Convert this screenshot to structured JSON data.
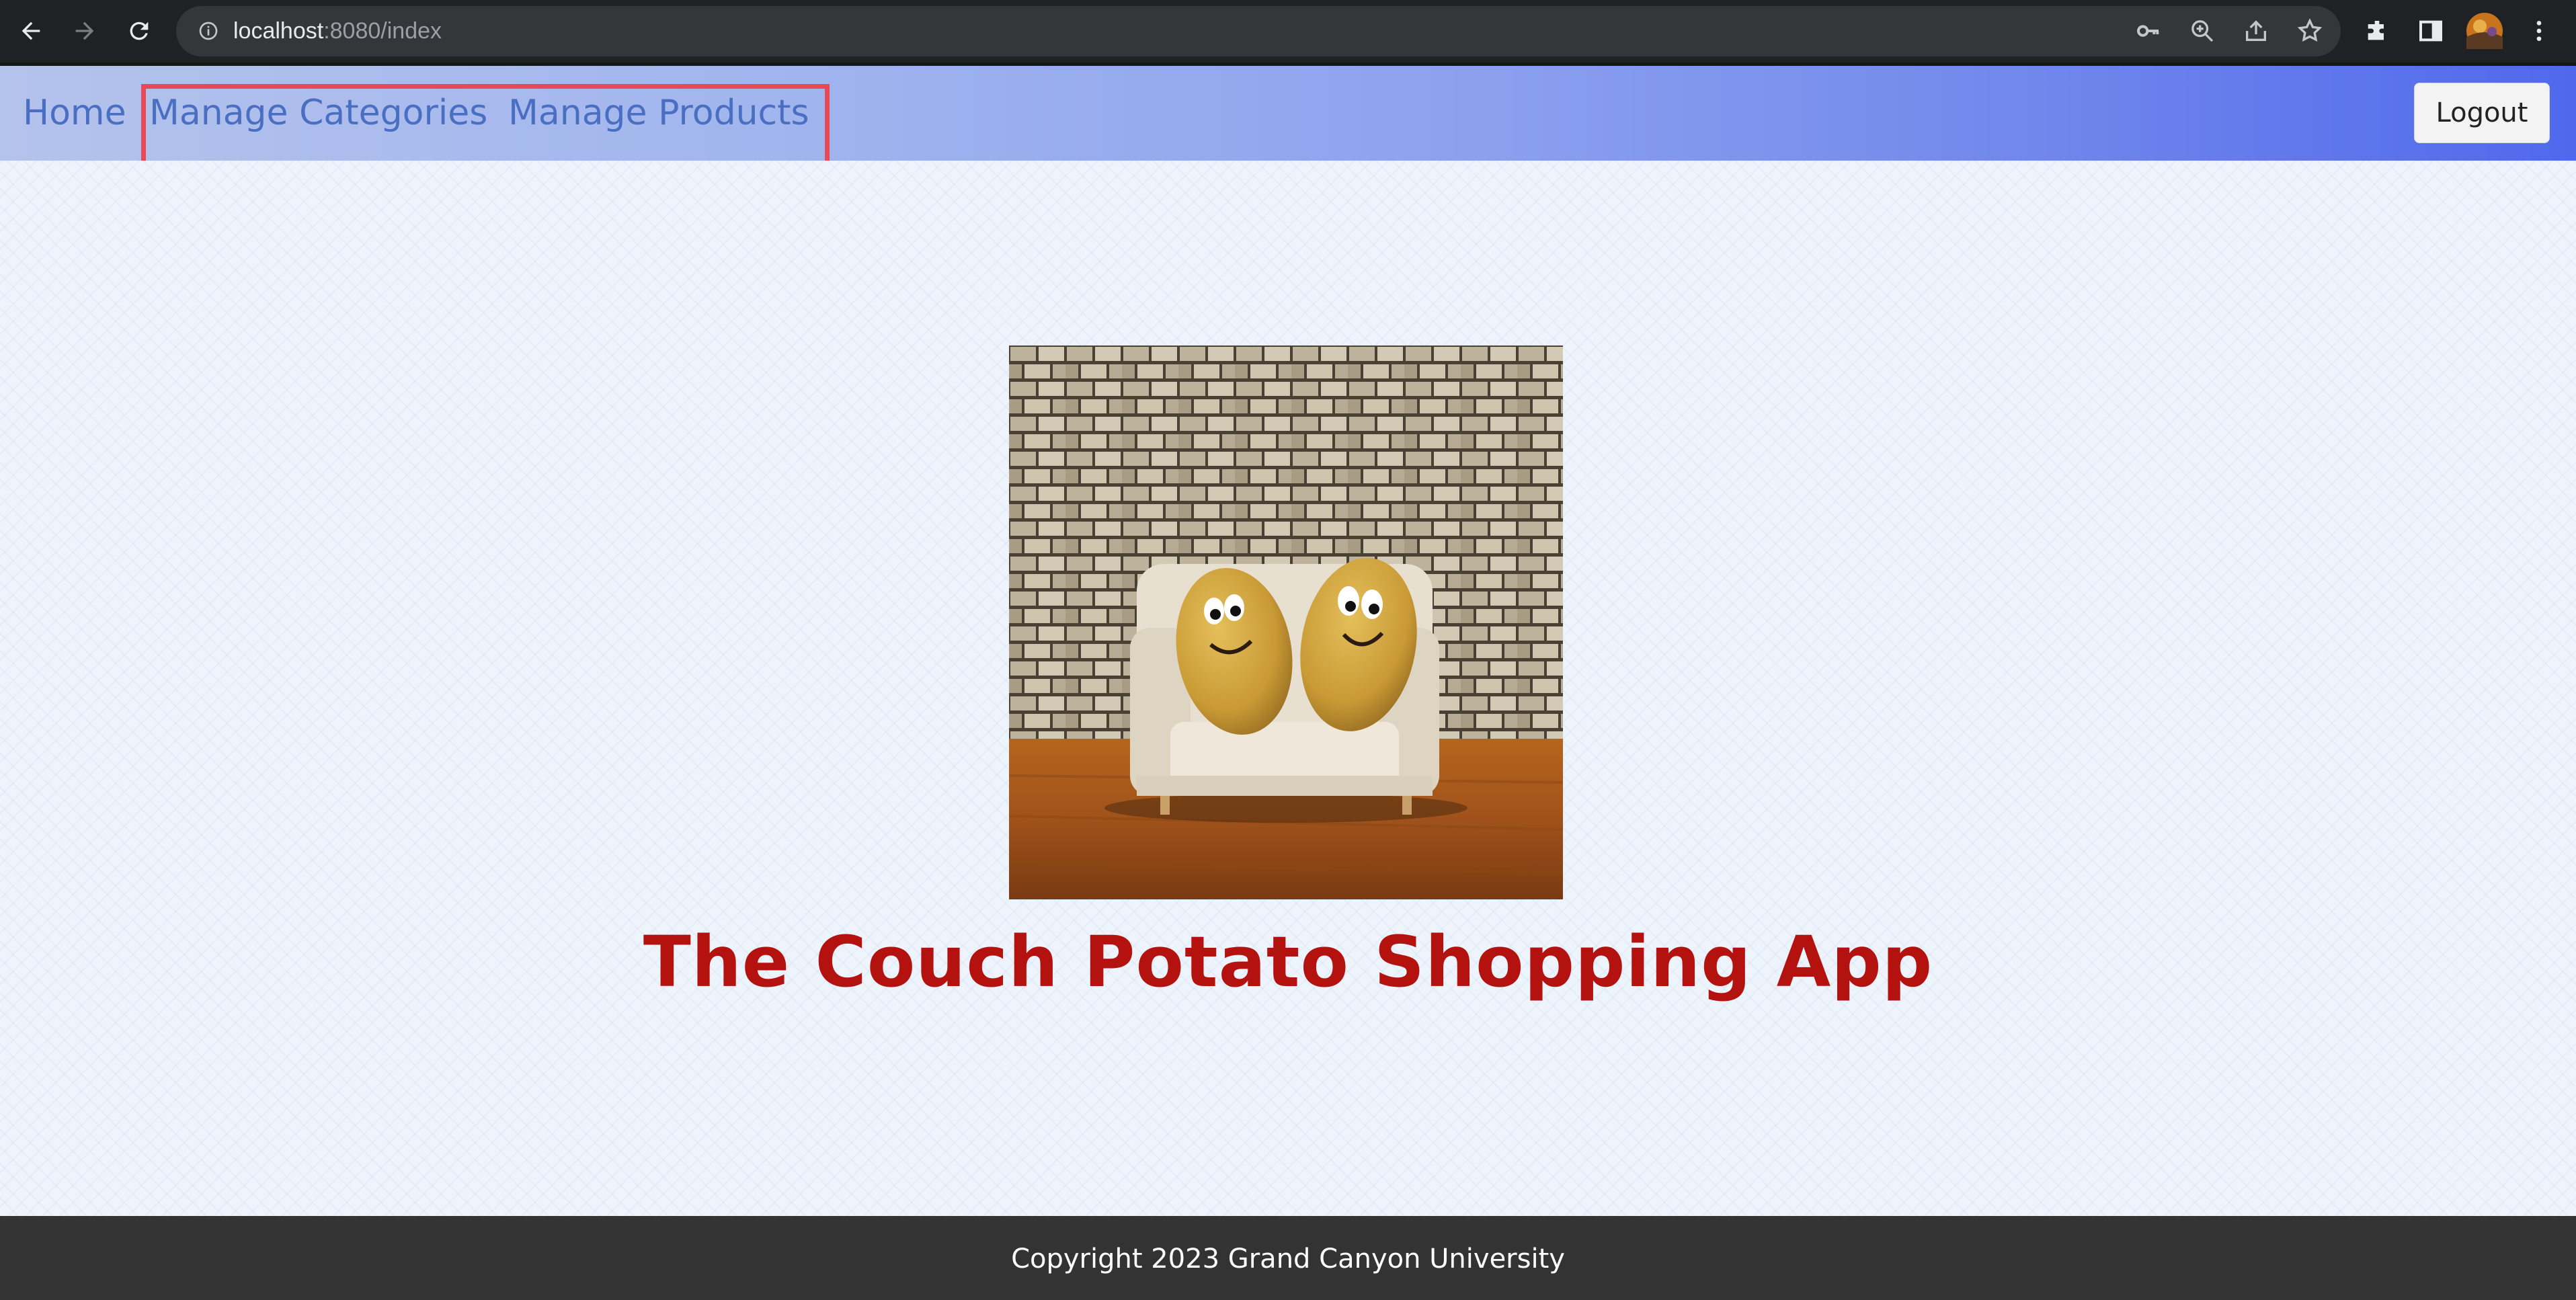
{
  "browser": {
    "url_host": "localhost",
    "url_path": ":8080/index",
    "icons": [
      "back-icon",
      "forward-icon",
      "reload-icon",
      "site-info-icon",
      "key-icon",
      "zoom-icon",
      "share-icon",
      "bookmark-star-icon",
      "extensions-icon",
      "side-panel-icon",
      "profile-avatar",
      "menu-icon"
    ]
  },
  "nav": {
    "home": "Home",
    "manage_categories": "Manage Categories",
    "manage_products": "Manage Products",
    "logout": "Logout"
  },
  "main": {
    "hero_image": "couch-potato-image",
    "title": "The Couch Potato Shopping App"
  },
  "footer": {
    "copyright": "Copyright 2023 Grand Canyon University"
  },
  "colors": {
    "title": "#b3120f",
    "nav_link": "#4a6fc2",
    "highlight_box": "#e84a55",
    "footer_bg": "#333333"
  }
}
